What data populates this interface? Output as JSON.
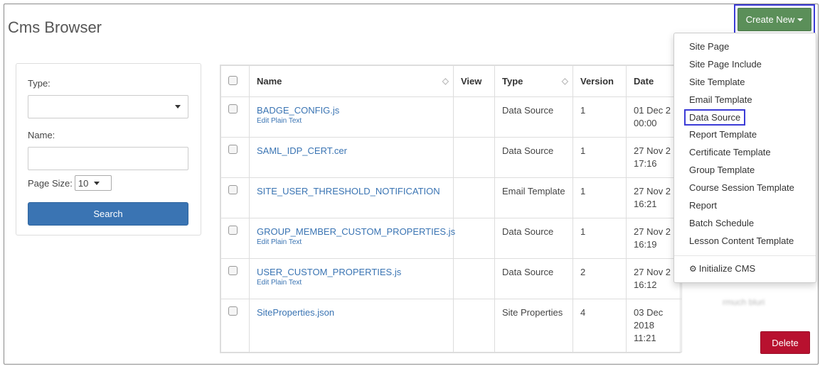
{
  "header": {
    "title": "Cms Browser",
    "create_label": "Create New"
  },
  "filters": {
    "type_label": "Type:",
    "type_value": "",
    "name_label": "Name:",
    "name_value": "",
    "page_size_label": "Page Size:",
    "page_size_value": "10",
    "search_label": "Search"
  },
  "table": {
    "columns": [
      "Name",
      "View",
      "Type",
      "Version",
      "Date"
    ],
    "rows": [
      {
        "name": "BADGE_CONFIG.js",
        "sub": "Edit Plain Text",
        "type": "Data Source",
        "version": "1",
        "date": "01 Dec 2",
        "time": "00:00",
        "user": ""
      },
      {
        "name": "SAML_IDP_CERT.cer",
        "sub": "",
        "type": "Data Source",
        "version": "1",
        "date": "27 Nov 2",
        "time": "17:16",
        "user": ""
      },
      {
        "name": "SITE_USER_THRESHOLD_NOTIFICATION",
        "sub": "",
        "type": "Email Template",
        "version": "1",
        "date": "27 Nov 2",
        "time": "16:21",
        "user": ""
      },
      {
        "name": "GROUP_MEMBER_CUSTOM_PROPERTIES.js",
        "sub": "Edit Plain Text",
        "type": "Data Source",
        "version": "1",
        "date": "27 Nov 2",
        "time": "16:19",
        "user": ""
      },
      {
        "name": "USER_CUSTOM_PROPERTIES.js",
        "sub": "Edit Plain Text",
        "type": "Data Source",
        "version": "2",
        "date": "27 Nov 2",
        "time": "16:12",
        "user": ""
      },
      {
        "name": "SiteProperties.json",
        "sub": "",
        "type": "Site Properties",
        "version": "4",
        "date": "03 Dec 2018",
        "time": "11:21",
        "user": "rmuch bluri"
      }
    ]
  },
  "menu": {
    "items": [
      "Site Page",
      "Site Page Include",
      "Site Template",
      "Email Template",
      "Data Source",
      "Report Template",
      "Certificate Template",
      "Group Template",
      "Course Session Template",
      "Report",
      "Batch Schedule",
      "Lesson Content Template"
    ],
    "highlighted_index": 4,
    "initialize_label": "Initialize CMS",
    "initialize_icon": "gears-icon"
  },
  "actions": {
    "delete_label": "Delete"
  },
  "colors": {
    "create_button": "#5b8f59",
    "search_button": "#3a74b3",
    "delete_button": "#b8112f",
    "link": "#3a74b3",
    "highlight_border": "#3b3bd6"
  }
}
